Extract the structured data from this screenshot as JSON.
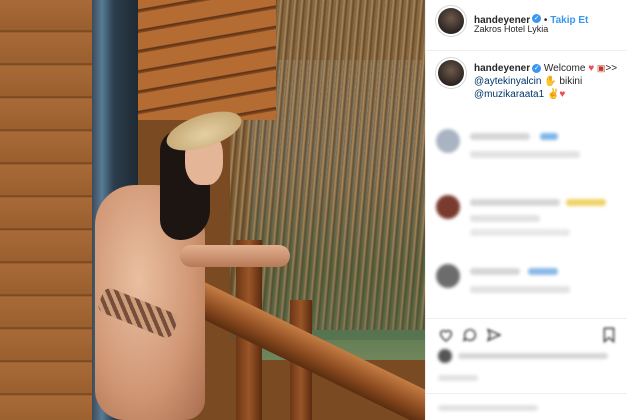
{
  "post": {
    "username": "handeyener",
    "follow_label": "Takip Et",
    "location": "Zakros Hotel Lykia"
  },
  "caption": {
    "username": "handeyener",
    "text_welcome": "Welcome",
    "mention_1": "@aytekinyalcin",
    "text_bikini": "bikini",
    "mention_2": "@muzikaraata1"
  },
  "icons": {
    "verified": "verified-badge-icon",
    "heart": "red-heart-emoji",
    "camera": "camera-emoji",
    "arrows": ">>",
    "hand": "hand-emoji",
    "clap": "clap-emoji"
  },
  "colors": {
    "link": "#3897f0",
    "mention": "#003569",
    "heart": "#ed4956",
    "text": "#262626"
  }
}
